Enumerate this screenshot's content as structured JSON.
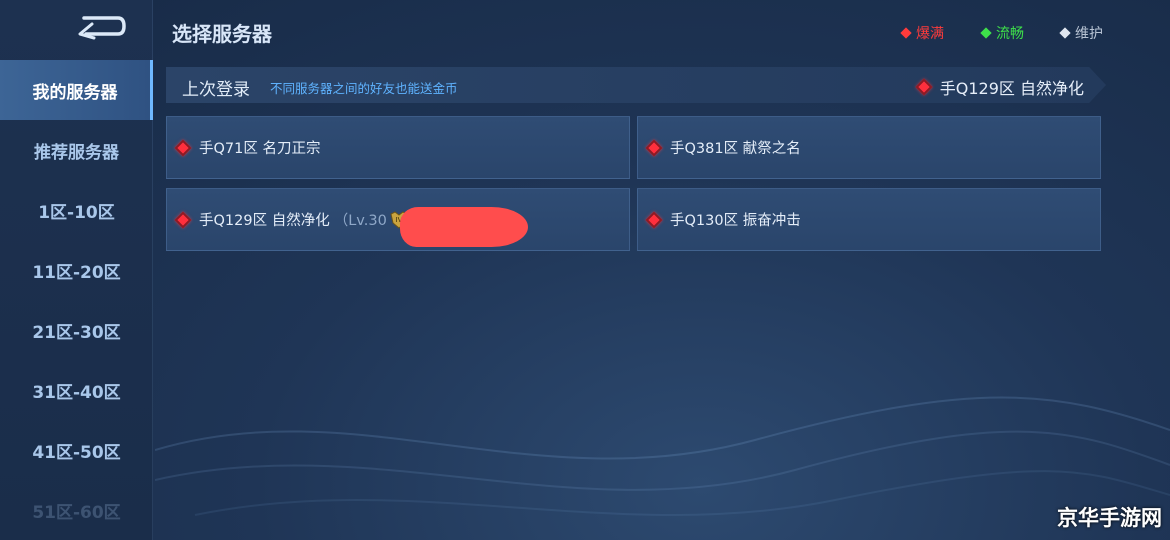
{
  "header": {
    "title": "选择服务器",
    "legend": [
      {
        "label": "爆满",
        "color": "#ff3b3b"
      },
      {
        "label": "流畅",
        "color": "#3ee04a"
      },
      {
        "label": "维护",
        "color": "#b8c4d4"
      }
    ]
  },
  "sidebar": {
    "items": [
      {
        "label": "我的服务器",
        "active": true
      },
      {
        "label": "推荐服务器"
      },
      {
        "label": "1区-10区"
      },
      {
        "label": "11区-20区"
      },
      {
        "label": "21区-30区"
      },
      {
        "label": "31区-40区"
      },
      {
        "label": "41区-50区"
      },
      {
        "label": "51区-60区"
      }
    ]
  },
  "last_login": {
    "label": "上次登录",
    "hint": "不同服务器之间的好友也能送金币",
    "server": "手Q129区 自然净化",
    "status_color": "#ff2f3d"
  },
  "servers": [
    {
      "name": "手Q71区 名刀正宗"
    },
    {
      "name": "手Q381区 献祭之名"
    },
    {
      "name": "手Q129区 自然净化",
      "level": "（Lv.30"
    },
    {
      "name": "手Q130区 振奋冲击"
    }
  ],
  "watermark": "京华手游网"
}
